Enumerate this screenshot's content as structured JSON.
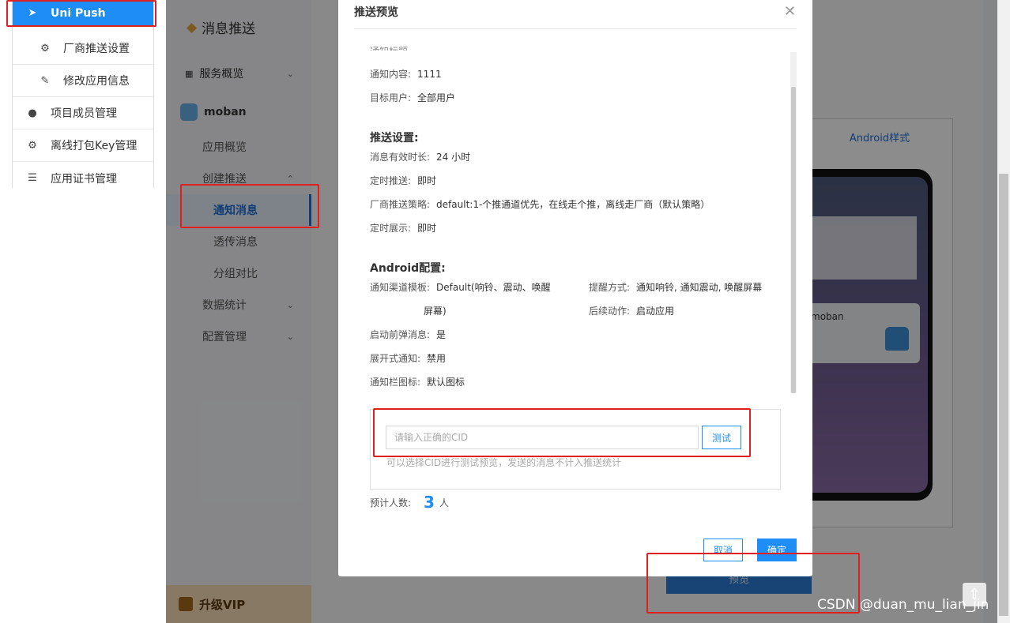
{
  "left_menu": {
    "items": [
      {
        "label": "Uni Push",
        "icon": "send-icon",
        "active": true
      },
      {
        "label": "厂商推送设置",
        "icon": "gear-icon"
      },
      {
        "label": "修改应用信息",
        "icon": "edit-icon"
      },
      {
        "label": "项目成员管理",
        "icon": "user-icon"
      },
      {
        "label": "离线打包Key管理",
        "icon": "gear-icon"
      },
      {
        "label": "应用证书管理",
        "icon": "list-icon"
      }
    ]
  },
  "sidebar": {
    "title": "消息推送",
    "items": [
      {
        "label": "服务概览"
      },
      {
        "label": "moban"
      },
      {
        "label": "应用概览"
      },
      {
        "label": "创建推送"
      },
      {
        "label": "通知消息"
      },
      {
        "label": "透传消息"
      },
      {
        "label": "分组对比"
      },
      {
        "label": "数据统计"
      },
      {
        "label": "配置管理"
      }
    ],
    "vip_label": "升级VIP"
  },
  "background": {
    "android_style_label": "Android样式",
    "phone_app_name": "moban",
    "preview_button": "预览"
  },
  "modal": {
    "title": "推送预览",
    "cut_top": "通知标题",
    "notify_content_label": "通知内容:",
    "notify_content_value": "1111",
    "target_users_label": "目标用户:",
    "target_users_value": "全部用户",
    "push_settings_title": "推送设置:",
    "validity_label": "消息有效时长:",
    "validity_value": "24 小时",
    "scheduled_label": "定时推送:",
    "scheduled_value": "即时",
    "vendor_strategy_label": "厂商推送策略:",
    "vendor_strategy_value": "default:1-个推通道优先，在线走个推，离线走厂商（默认策略）",
    "scheduled_display_label": "定时展示:",
    "scheduled_display_value": "即时",
    "android_config_title": "Android配置:",
    "channel_template_label": "通知渠道模板:",
    "channel_template_value_1": "Default(响铃、震动、唤醒",
    "channel_template_value_2": "屏幕)",
    "reminder_label": "提醒方式:",
    "reminder_value": "通知响铃, 通知震动, 唤醒屏幕",
    "followup_label": "后续动作:",
    "followup_value": "启动应用",
    "popup_label": "启动前弹消息:",
    "popup_value": "是",
    "expand_label": "展开式通知:",
    "expand_value": "禁用",
    "icon_label": "通知栏图标:",
    "icon_value": "默认图标",
    "cid_placeholder": "请输入正确的CID",
    "test_button": "测试",
    "cid_hint": "可以选择CID进行测试预览，发送的消息不计入推送统计",
    "estimate_label": "预计人数:",
    "estimate_value": "3",
    "estimate_unit": "人",
    "cancel_button": "取消",
    "ok_button": "确定"
  },
  "watermark": "CSDN @duan_mu_lian_jin"
}
